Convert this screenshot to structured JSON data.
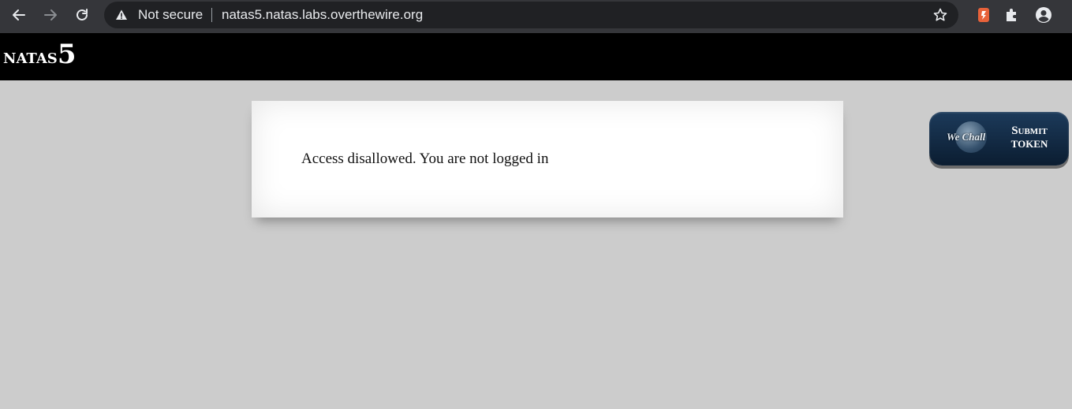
{
  "browser": {
    "security_label": "Not secure",
    "url": "natas5.natas.labs.overthewire.org",
    "icons": {
      "back": "arrow-left-icon",
      "forward": "arrow-right-icon",
      "reload": "reload-icon",
      "warning": "warning-triangle-icon",
      "bookmark": "star-icon",
      "extension1": "brave-extension-icon",
      "extensions": "puzzle-icon",
      "profile": "account-circle-icon"
    }
  },
  "header": {
    "title_main": "natas",
    "title_number": "5"
  },
  "content": {
    "message": "Access disallowed. You are not logged in"
  },
  "wechall": {
    "logo_text": "We Chall",
    "submit_label": "Submit",
    "token_label": "TOKEN"
  },
  "colors": {
    "browser_bar": "#35363a",
    "omnibox": "#202124",
    "header_bg": "#000000",
    "page_bg": "#cccccc",
    "content_bg": "#ffffff",
    "button_bg": "#0b1d31"
  }
}
